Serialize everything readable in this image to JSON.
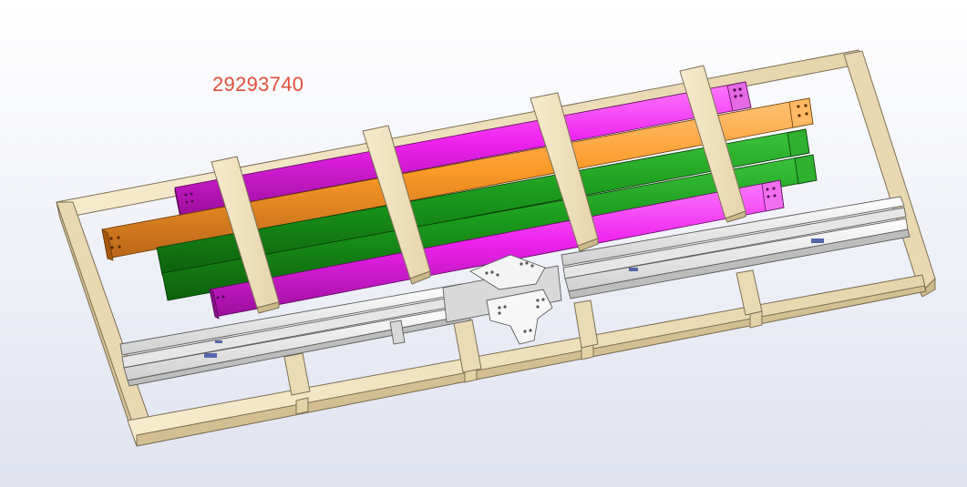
{
  "viewport": {
    "part_number": "29293740",
    "background_colors": [
      "#ffffff",
      "#dfe3ef"
    ]
  },
  "model": {
    "description_icon": "cad-assembly",
    "colors": {
      "wood": "#f2e2be",
      "wood_edge": "#8a7a5c",
      "magenta": "#ee22ee",
      "orange": "#fb9a26",
      "green": "#1b9a1b",
      "aluminum": "#f2f2f2",
      "aluminum_edge": "#6a6a6a"
    }
  }
}
